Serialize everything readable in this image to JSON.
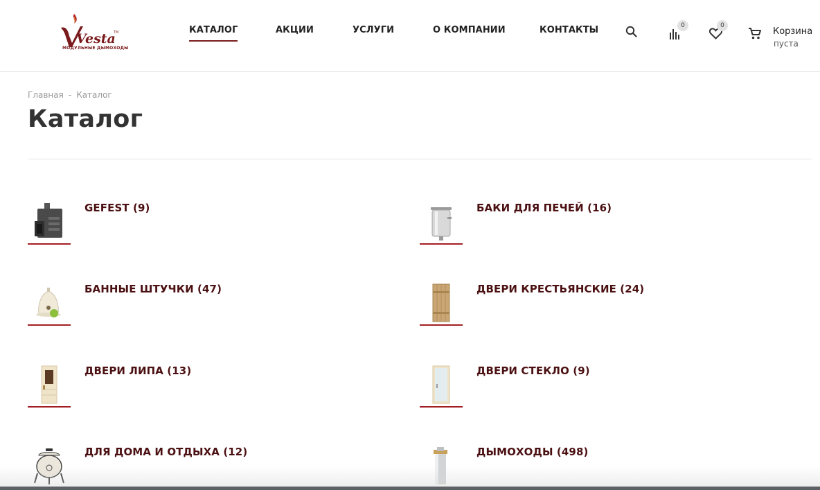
{
  "brand": {
    "name": "Vesta",
    "tm": "TM",
    "tagline": "МОДУЛЬНЫЕ ДЫМОХОДЫ",
    "color": "#7a1a1c"
  },
  "nav": {
    "items": [
      {
        "label": "КАТАЛОГ",
        "active": true
      },
      {
        "label": "АКЦИИ"
      },
      {
        "label": "УСЛУГИ"
      },
      {
        "label": "О КОМПАНИИ"
      },
      {
        "label": "КОНТАКТЫ"
      }
    ]
  },
  "header_icons": {
    "search": "search-icon",
    "compare": {
      "icon": "compare-icon",
      "count": "0"
    },
    "favorites": {
      "icon": "heart-icon",
      "count": "0"
    },
    "cart": {
      "icon": "cart-icon",
      "label": "Корзина",
      "status": "пуста"
    }
  },
  "breadcrumb": {
    "home": "Главная",
    "separator": "-",
    "current": "Каталог"
  },
  "page": {
    "title": "Каталог"
  },
  "catalog": {
    "accent": "#a31e22",
    "items": [
      {
        "title": "GEFEST (9)",
        "icon": "stove-icon"
      },
      {
        "title": "БАКИ ДЛЯ ПЕЧЕЙ (16)",
        "icon": "water-tank-icon"
      },
      {
        "title": "БАННЫЕ ШТУЧКИ (47)",
        "icon": "sauna-hat-icon"
      },
      {
        "title": "ДВЕРИ КРЕСТЬЯНСКИЕ (24)",
        "icon": "wooden-door-icon"
      },
      {
        "title": "ДВЕРИ ЛИПА (13)",
        "icon": "linden-door-icon"
      },
      {
        "title": "ДВЕРИ СТЕКЛО (9)",
        "icon": "glass-door-icon"
      },
      {
        "title": "ДЛЯ ДОМА И ОТДЫХА (12)",
        "icon": "tandoor-icon"
      },
      {
        "title": "ДЫМОХОДЫ (498)",
        "icon": "chimney-pipe-icon"
      }
    ]
  }
}
